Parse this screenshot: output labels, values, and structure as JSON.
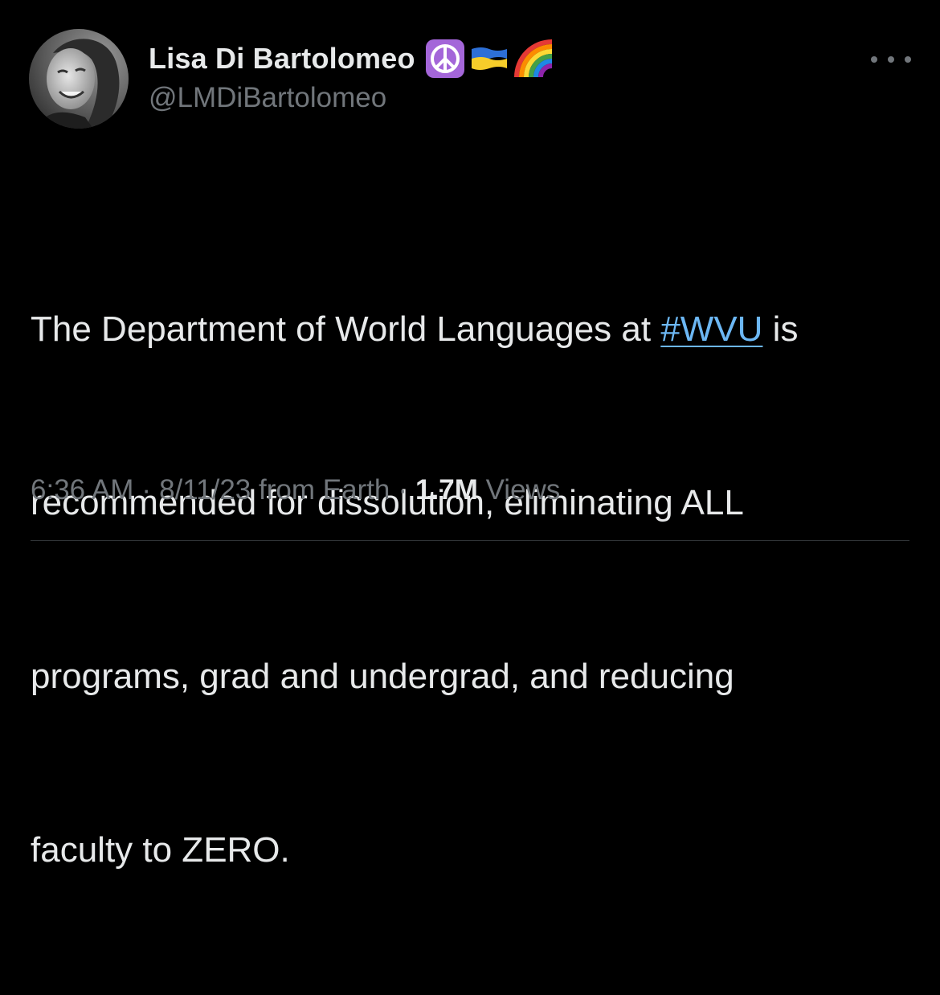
{
  "author": {
    "display_name": "Lisa Di Bartolomeo",
    "handle": "@LMDiBartolomeo",
    "name_emojis": [
      "peace-symbol",
      "ukraine-flag",
      "rainbow"
    ]
  },
  "tweet": {
    "text_lines": {
      "l1_before": "The Department of World Languages at ",
      "l1_hashtag": "#WVU",
      "l1_after": " is",
      "l2": "recommended for dissolution, eliminating ALL",
      "l3": "programs, grad and undergrad, and reducing",
      "l4": "faculty to ZERO."
    }
  },
  "meta": {
    "time": "6:36 AM",
    "date": "8/11/23",
    "source": "from Earth",
    "separator": "·",
    "views_count": "1.7M",
    "views_label": "Views"
  },
  "colors": {
    "background": "#000000",
    "text_primary": "#e7e9ea",
    "text_secondary": "#71767b",
    "link": "#6cb7f4",
    "peace_purple": "#a466d9",
    "divider": "#2f3336"
  },
  "icons": {
    "more": "more-horizontal-icon"
  }
}
